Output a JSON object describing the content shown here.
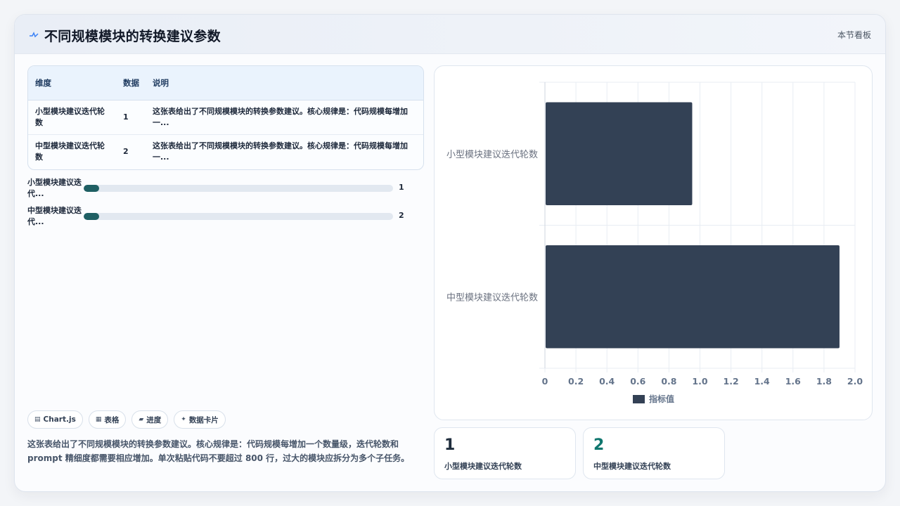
{
  "header": {
    "title": "不同规模模块的转换建议参数",
    "link_label": "本节看板"
  },
  "table": {
    "columns": [
      "维度",
      "数据",
      "说明"
    ],
    "rows": [
      {
        "dimension": "小型模块建议迭代轮数",
        "value": "1",
        "note": "这张表给出了不同规模模块的转换参数建议。核心规律是：代码规模每增加一..."
      },
      {
        "dimension": "中型模块建议迭代轮数",
        "value": "2",
        "note": "这张表给出了不同规模模块的转换参数建议。核心规律是：代码规模每增加一..."
      }
    ]
  },
  "progress": [
    {
      "label": "小型模块建议迭代...",
      "value": "1",
      "fraction": 0.05
    },
    {
      "label": "中型模块建议迭代...",
      "value": "2",
      "fraction": 0.05
    }
  ],
  "tags": [
    {
      "icon": "chart-icon",
      "label": "Chart.js"
    },
    {
      "icon": "table-icon",
      "label": "表格"
    },
    {
      "icon": "progress-icon",
      "label": "进度"
    },
    {
      "icon": "sparkle-icon",
      "label": "数据卡片"
    }
  ],
  "summary": "这张表给出了不同规模模块的转换参数建议。核心规律是：代码规模每增加一个数量级，迭代轮数和 prompt 精细度都需要相应增加。单次粘贴代码不要超过 800 行，过大的模块应拆分为多个子任务。",
  "stats": [
    {
      "value": "1",
      "label": "小型模块建议迭代轮数",
      "color": "#1f2d3d"
    },
    {
      "value": "2",
      "label": "中型模块建议迭代轮数",
      "color": "#0f766e"
    }
  ],
  "chart_data": {
    "type": "bar",
    "orientation": "horizontal",
    "categories": [
      "小型模块建议迭代轮数",
      "中型模块建议迭代轮数"
    ],
    "series": [
      {
        "name": "指标值",
        "values": [
          0.95,
          1.9
        ],
        "color": "#334155"
      }
    ],
    "xlim": [
      0,
      2.0
    ],
    "xticks": [
      "0",
      "0.2",
      "0.4",
      "0.6",
      "0.8",
      "1.0",
      "1.2",
      "1.4",
      "1.6",
      "1.8",
      "2.0"
    ],
    "grid": true,
    "legend": "bottom"
  }
}
